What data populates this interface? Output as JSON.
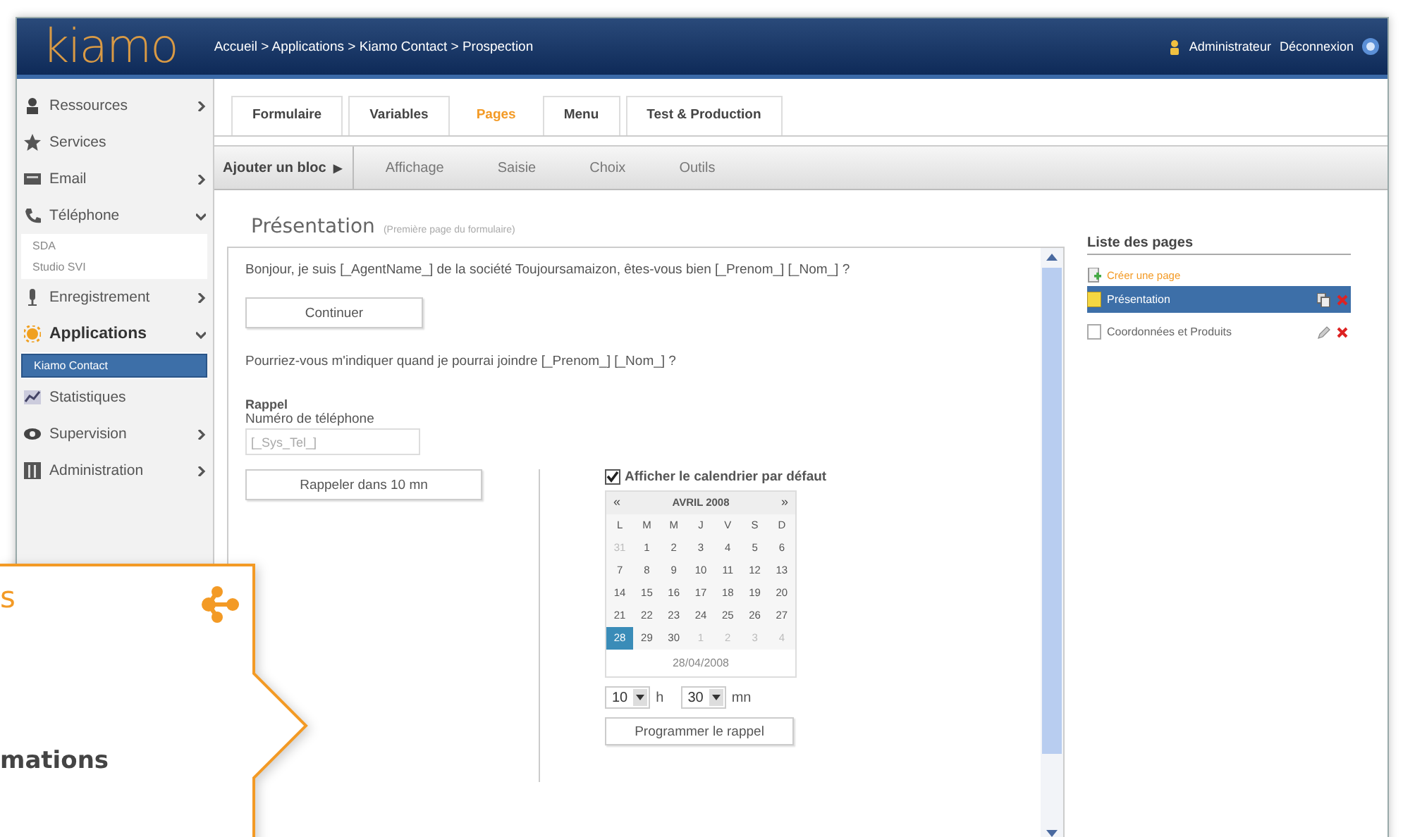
{
  "header": {
    "logo": "kiamo",
    "breadcrumb": "Accueil > Applications > Kiamo Contact > Prospection",
    "user": "Administrateur",
    "logout": "Déconnexion"
  },
  "sidebar": {
    "items": [
      {
        "label": "Ressources",
        "kind": "group",
        "expanded": false,
        "selected": false
      },
      {
        "label": "Services",
        "kind": "link",
        "selected": false
      },
      {
        "label": "Email",
        "kind": "group",
        "expanded": false,
        "selected": false
      },
      {
        "label": "Téléphone",
        "kind": "group",
        "expanded": true,
        "selected": false,
        "children": [
          {
            "label": "SDA",
            "selected": false
          },
          {
            "label": "Studio SVI",
            "selected": false
          }
        ]
      },
      {
        "label": "Enregistrement",
        "kind": "group",
        "expanded": false,
        "selected": false
      },
      {
        "label": "Applications",
        "kind": "group",
        "expanded": true,
        "selected": true,
        "children": [
          {
            "label": "Kiamo Contact",
            "selected": true
          }
        ]
      },
      {
        "label": "Statistiques",
        "kind": "link",
        "selected": false
      },
      {
        "label": "Supervision",
        "kind": "group",
        "expanded": false,
        "selected": false
      },
      {
        "label": "Administration",
        "kind": "group",
        "expanded": false,
        "selected": false
      }
    ]
  },
  "tabs": [
    {
      "label": "Formulaire",
      "selected": false
    },
    {
      "label": "Variables",
      "selected": false
    },
    {
      "label": "Pages",
      "selected": true
    },
    {
      "label": "Menu",
      "selected": false
    },
    {
      "label": "Test & Production",
      "selected": false
    }
  ],
  "toolbar": {
    "add_block": "Ajouter un bloc",
    "arrow": "▶",
    "items": [
      "Affichage",
      "Saisie",
      "Choix",
      "Outils"
    ]
  },
  "page": {
    "title": "Présentation",
    "subtitle": "(Première page du formulaire)"
  },
  "form": {
    "greeting": "Bonjour, je suis [_AgentName_] de la société Toujoursamaizon, êtes-vous bien [_Prenom_] [_Nom_] ?",
    "continue_button": "Continuer",
    "question": "Pourriez-vous m'indiquer quand je pourrai joindre [_Prenom_] [_Nom_] ?",
    "section": "Rappel",
    "phone_label": "Numéro de téléphone",
    "phone_value": "[_Sys_Tel_]",
    "recall_button": "Rappeler dans 10 mn",
    "show_calendar": {
      "label": "Afficher le calendrier par défaut",
      "checked": true
    },
    "calendar": {
      "prev": "«",
      "month": "AVRIL 2008",
      "next": "»",
      "weekdays": [
        "L",
        "M",
        "M",
        "J",
        "V",
        "S",
        "D"
      ],
      "weeks": [
        [
          {
            "day": "31",
            "other_month": true,
            "selected": false
          },
          {
            "day": "1",
            "other_month": false,
            "selected": false
          },
          {
            "day": "2",
            "other_month": false,
            "selected": false
          },
          {
            "day": "3",
            "other_month": false,
            "selected": false
          },
          {
            "day": "4",
            "other_month": false,
            "selected": false
          },
          {
            "day": "5",
            "other_month": false,
            "selected": false
          },
          {
            "day": "6",
            "other_month": false,
            "selected": false
          }
        ],
        [
          {
            "day": "7",
            "other_month": false,
            "selected": false
          },
          {
            "day": "8",
            "other_month": false,
            "selected": false
          },
          {
            "day": "9",
            "other_month": false,
            "selected": false
          },
          {
            "day": "10",
            "other_month": false,
            "selected": false
          },
          {
            "day": "11",
            "other_month": false,
            "selected": false
          },
          {
            "day": "12",
            "other_month": false,
            "selected": false
          },
          {
            "day": "13",
            "other_month": false,
            "selected": false
          }
        ],
        [
          {
            "day": "14",
            "other_month": false,
            "selected": false
          },
          {
            "day": "15",
            "other_month": false,
            "selected": false
          },
          {
            "day": "16",
            "other_month": false,
            "selected": false
          },
          {
            "day": "17",
            "other_month": false,
            "selected": false
          },
          {
            "day": "18",
            "other_month": false,
            "selected": false
          },
          {
            "day": "19",
            "other_month": false,
            "selected": false
          },
          {
            "day": "20",
            "other_month": false,
            "selected": false
          }
        ],
        [
          {
            "day": "21",
            "other_month": false,
            "selected": false
          },
          {
            "day": "22",
            "other_month": false,
            "selected": false
          },
          {
            "day": "23",
            "other_month": false,
            "selected": false
          },
          {
            "day": "24",
            "other_month": false,
            "selected": false
          },
          {
            "day": "25",
            "other_month": false,
            "selected": false
          },
          {
            "day": "26",
            "other_month": false,
            "selected": false
          },
          {
            "day": "27",
            "other_month": false,
            "selected": false
          }
        ],
        [
          {
            "day": "28",
            "other_month": false,
            "selected": true
          },
          {
            "day": "29",
            "other_month": false,
            "selected": false
          },
          {
            "day": "30",
            "other_month": false,
            "selected": false
          },
          {
            "day": "1",
            "other_month": true,
            "selected": false
          },
          {
            "day": "2",
            "other_month": true,
            "selected": false
          },
          {
            "day": "3",
            "other_month": true,
            "selected": false
          },
          {
            "day": "4",
            "other_month": true,
            "selected": false
          }
        ]
      ],
      "date": "28/04/2008"
    },
    "hour": "10",
    "hour_unit": "h",
    "minute": "30",
    "minute_unit": "mn",
    "schedule_button": "Programmer le rappel"
  },
  "page_list": {
    "title": "Liste des pages",
    "create": "Créer une page",
    "pages": [
      {
        "label": "Présentation",
        "selected": true
      },
      {
        "label": "Coordonnées et Produits",
        "selected": false
      }
    ]
  },
  "callout": {
    "heading": "s",
    "text": "mations"
  }
}
